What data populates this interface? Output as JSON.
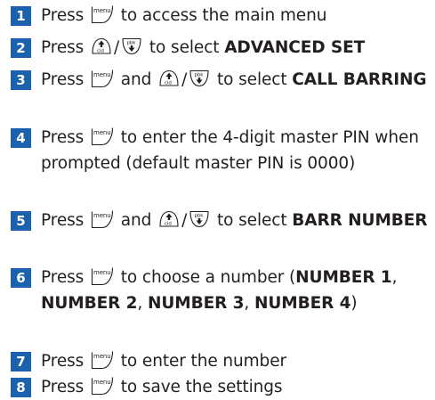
{
  "steps": [
    {
      "number": "1",
      "parts": [
        {
          "type": "text",
          "value": "Press "
        },
        {
          "type": "key",
          "key": "menu-key"
        },
        {
          "type": "text",
          "value": " to access the main menu"
        }
      ]
    },
    {
      "number": "2",
      "parts": [
        {
          "type": "text",
          "value": "Press "
        },
        {
          "type": "key",
          "key": "up-cid-key"
        },
        {
          "type": "text",
          "value": "/"
        },
        {
          "type": "key",
          "key": "down-pbk-key"
        },
        {
          "type": "text",
          "value": " to select "
        },
        {
          "type": "bold",
          "value": "ADVANCED SET"
        }
      ]
    },
    {
      "number": "3",
      "parts": [
        {
          "type": "text",
          "value": "Press "
        },
        {
          "type": "key",
          "key": "menu-key"
        },
        {
          "type": "text",
          "value": " and "
        },
        {
          "type": "key",
          "key": "up-cid-key"
        },
        {
          "type": "text",
          "value": "/"
        },
        {
          "type": "key",
          "key": "down-pbk-key"
        },
        {
          "type": "text",
          "value": " to select "
        },
        {
          "type": "bold",
          "value": "CALL BARRING"
        }
      ]
    },
    {
      "number": "4",
      "parts": [
        {
          "type": "text",
          "value": "Press "
        },
        {
          "type": "key",
          "key": "menu-key"
        },
        {
          "type": "text",
          "value": " to enter the 4-digit master PIN when prompted (default master PIN is 0000)"
        }
      ]
    },
    {
      "number": "5",
      "parts": [
        {
          "type": "text",
          "value": "Press "
        },
        {
          "type": "key",
          "key": "menu-key"
        },
        {
          "type": "text",
          "value": " and "
        },
        {
          "type": "key",
          "key": "up-cid-key"
        },
        {
          "type": "text",
          "value": "/"
        },
        {
          "type": "key",
          "key": "down-pbk-key"
        },
        {
          "type": "text",
          "value": " to select "
        },
        {
          "type": "bold",
          "value": "BARR NUMBER"
        }
      ]
    },
    {
      "number": "6",
      "parts": [
        {
          "type": "text",
          "value": "Press "
        },
        {
          "type": "key",
          "key": "menu-key"
        },
        {
          "type": "text",
          "value": " to choose a number ("
        },
        {
          "type": "bold",
          "value": "NUMBER 1"
        },
        {
          "type": "text",
          "value": ", "
        },
        {
          "type": "bold",
          "value": "NUMBER 2"
        },
        {
          "type": "text",
          "value": ", "
        },
        {
          "type": "bold",
          "value": "NUMBER 3"
        },
        {
          "type": "text",
          "value": ", "
        },
        {
          "type": "bold",
          "value": "NUMBER 4"
        },
        {
          "type": "text",
          "value": ")"
        }
      ]
    },
    {
      "number": "7",
      "parts": [
        {
          "type": "text",
          "value": "Press "
        },
        {
          "type": "key",
          "key": "menu-key"
        },
        {
          "type": "text",
          "value": " to enter the number"
        }
      ]
    },
    {
      "number": "8",
      "parts": [
        {
          "type": "text",
          "value": "Press "
        },
        {
          "type": "key",
          "key": "menu-key"
        },
        {
          "type": "text",
          "value": " to save the settings"
        }
      ]
    }
  ],
  "keys": {
    "menu-key": {
      "label": "menu",
      "icon": "menu-key-icon"
    },
    "up-cid-key": {
      "label": "cid",
      "icon": "up-arrow-key-icon"
    },
    "down-pbk-key": {
      "label": "pbk",
      "icon": "down-arrow-key-icon"
    }
  },
  "colors": {
    "step_badge": "#1a62ad",
    "text": "#231f20"
  }
}
